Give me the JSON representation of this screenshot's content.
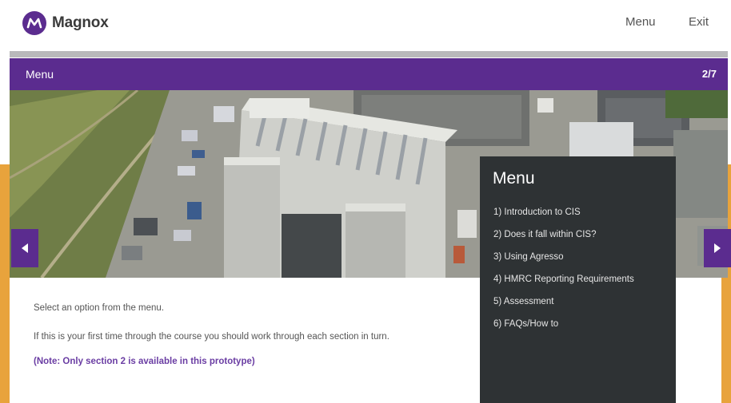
{
  "header": {
    "brand": "Magnox",
    "menu_link": "Menu",
    "exit_link": "Exit"
  },
  "title_bar": {
    "title": "Menu",
    "page_indicator": "2/7"
  },
  "content": {
    "line1": "Select an option from the menu.",
    "line2": "If this is your first time through the course you should work through each section in turn.",
    "note": "(Note: Only section 2 is available in this prototype)"
  },
  "menu_panel": {
    "title": "Menu",
    "items": [
      {
        "label": "1) Introduction to CIS"
      },
      {
        "label": "2) Does it fall within CIS?"
      },
      {
        "label": "3) Using Agresso"
      },
      {
        "label": "4) HMRC Reporting Requirements"
      },
      {
        "label": "5) Assessment"
      },
      {
        "label": "6) FAQs/How to"
      }
    ]
  },
  "nav": {
    "prev_icon": "chevron-left-icon",
    "next_icon": "chevron-right-icon"
  },
  "colors": {
    "brand_purple": "#5b2c8f",
    "accent_orange": "#e8a33c",
    "menu_panel_bg": "#2e3234",
    "note_purple": "#6a3da3"
  }
}
